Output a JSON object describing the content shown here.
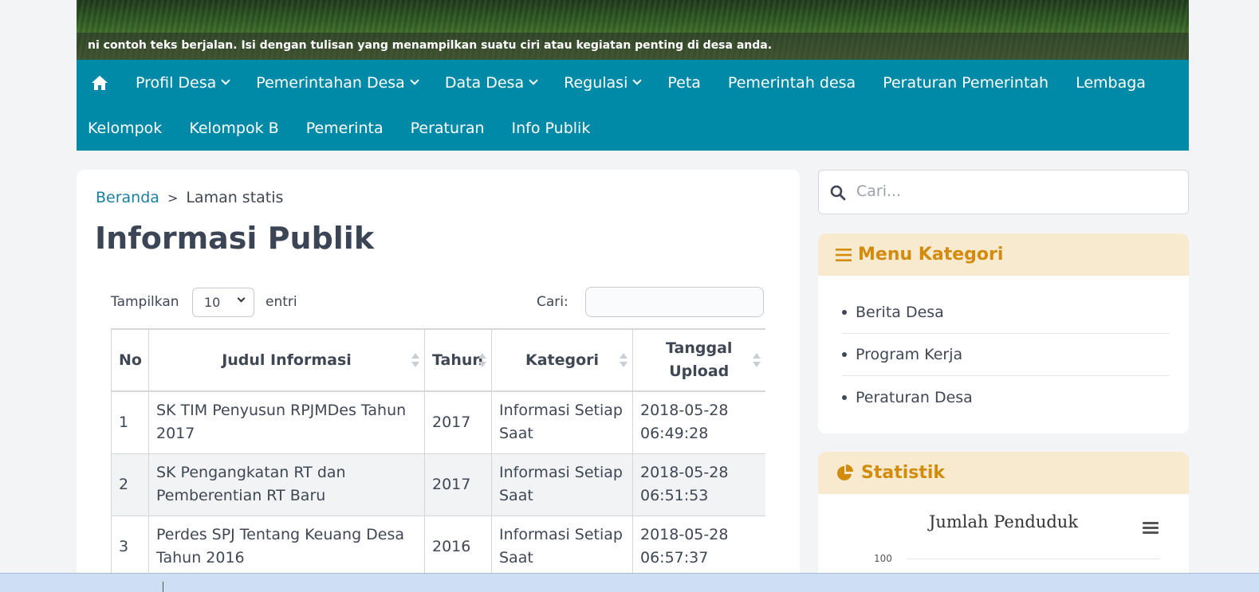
{
  "ticker_text": "ni contoh teks berjalan. Isi dengan tulisan yang menampilkan suatu ciri atau kegiatan penting di desa anda.",
  "nav": {
    "row1": [
      {
        "label": "Profil Desa",
        "dropdown": true
      },
      {
        "label": "Pemerintahan Desa",
        "dropdown": true
      },
      {
        "label": "Data Desa",
        "dropdown": true
      },
      {
        "label": "Regulasi",
        "dropdown": true
      },
      {
        "label": "Peta",
        "dropdown": false
      },
      {
        "label": "Pemerintah desa",
        "dropdown": false
      },
      {
        "label": "Peraturan Pemerintah",
        "dropdown": false
      },
      {
        "label": "Lembaga",
        "dropdown": false
      }
    ],
    "row2": [
      {
        "label": "Kelompok"
      },
      {
        "label": "Kelompok B"
      },
      {
        "label": "Pemerinta"
      },
      {
        "label": "Peraturan"
      },
      {
        "label": "Info Publik"
      }
    ]
  },
  "breadcrumb": {
    "home": "Beranda",
    "separator": ">",
    "current": "Laman statis"
  },
  "page_title": "Informasi Publik",
  "table_controls": {
    "show_label": "Tampilkan",
    "length_value": "10",
    "entries_label": "entri",
    "search_label": "Cari:"
  },
  "table": {
    "headers": [
      "No",
      "Judul Informasi",
      "Tahun",
      "Kategori",
      "Tanggal Upload"
    ],
    "rows": [
      [
        "1",
        "SK TIM Penyusun RPJMDes Tahun 2017",
        "2017",
        "Informasi Setiap Saat",
        "2018-05-28 06:49:28"
      ],
      [
        "2",
        "SK Pengangkatan RT dan Pemberentian RT Baru",
        "2017",
        "Informasi Setiap Saat",
        "2018-05-28 06:51:53"
      ],
      [
        "3",
        "Perdes SPJ Tentang Keuang Desa Tahun 2016",
        "2016",
        "Informasi Setiap Saat",
        "2018-05-28 06:57:37"
      ]
    ]
  },
  "sidebar": {
    "search_placeholder": "Cari...",
    "menu_kategori": {
      "title": "Menu Kategori",
      "items": [
        "Berita Desa",
        "Program Kerja",
        "Peraturan Desa"
      ]
    },
    "statistik": {
      "title": "Statistik",
      "chart_title": "Jumlah Penduduk",
      "ytick_top": "100"
    }
  },
  "colors": {
    "nav_bg": "#008aa8",
    "accent": "#d38b0e",
    "widget_head_bg": "#f8eacf",
    "link": "#1a7ea0"
  }
}
